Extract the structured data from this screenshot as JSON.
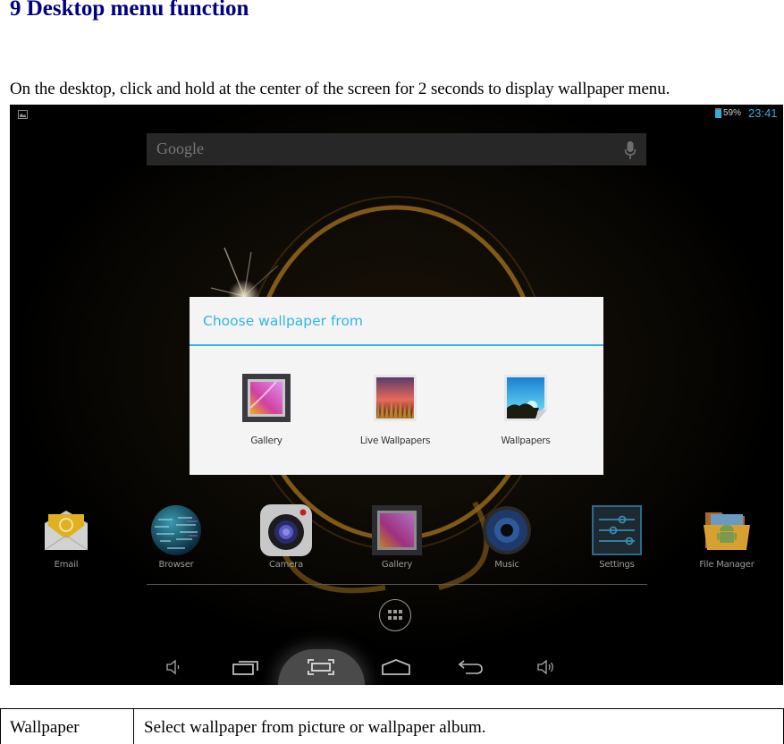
{
  "heading": "9 Desktop menu function",
  "intro": "On the desktop, click and hold at the center of the screen for 2 seconds to display wallpaper menu.",
  "screenshot": {
    "status_bar": {
      "notification_icon": "picture-icon",
      "battery_percent": "59%",
      "time": "23:41",
      "accent_color": "#33b5e5"
    },
    "search": {
      "placeholder": "Google",
      "mic_icon": "mic-icon"
    },
    "dialog": {
      "title": "Choose wallpaper from",
      "options": [
        {
          "label": "Gallery",
          "icon": "gallery-icon"
        },
        {
          "label": "Live Wallpapers",
          "icon": "live-wallpapers-icon"
        },
        {
          "label": "Wallpapers",
          "icon": "wallpapers-icon"
        }
      ]
    },
    "dock": {
      "apps": [
        {
          "label": "Email",
          "icon": "email-icon"
        },
        {
          "label": "Browser",
          "icon": "browser-icon"
        },
        {
          "label": "Camera",
          "icon": "camera-icon"
        },
        {
          "label": "Gallery",
          "icon": "gallery-icon"
        },
        {
          "label": "Music",
          "icon": "music-icon"
        },
        {
          "label": "Settings",
          "icon": "settings-icon"
        },
        {
          "label": "File Manager",
          "icon": "file-manager-icon"
        }
      ]
    },
    "all_apps_icon": "all-apps-icon",
    "nav_bar": [
      "volume-down-icon",
      "recent-apps-icon",
      "screenshot-icon",
      "home-icon",
      "back-icon",
      "volume-up-icon"
    ]
  },
  "table": {
    "rows": [
      {
        "term": "Wallpaper",
        "description": "Select wallpaper from picture or wallpaper album."
      }
    ]
  }
}
